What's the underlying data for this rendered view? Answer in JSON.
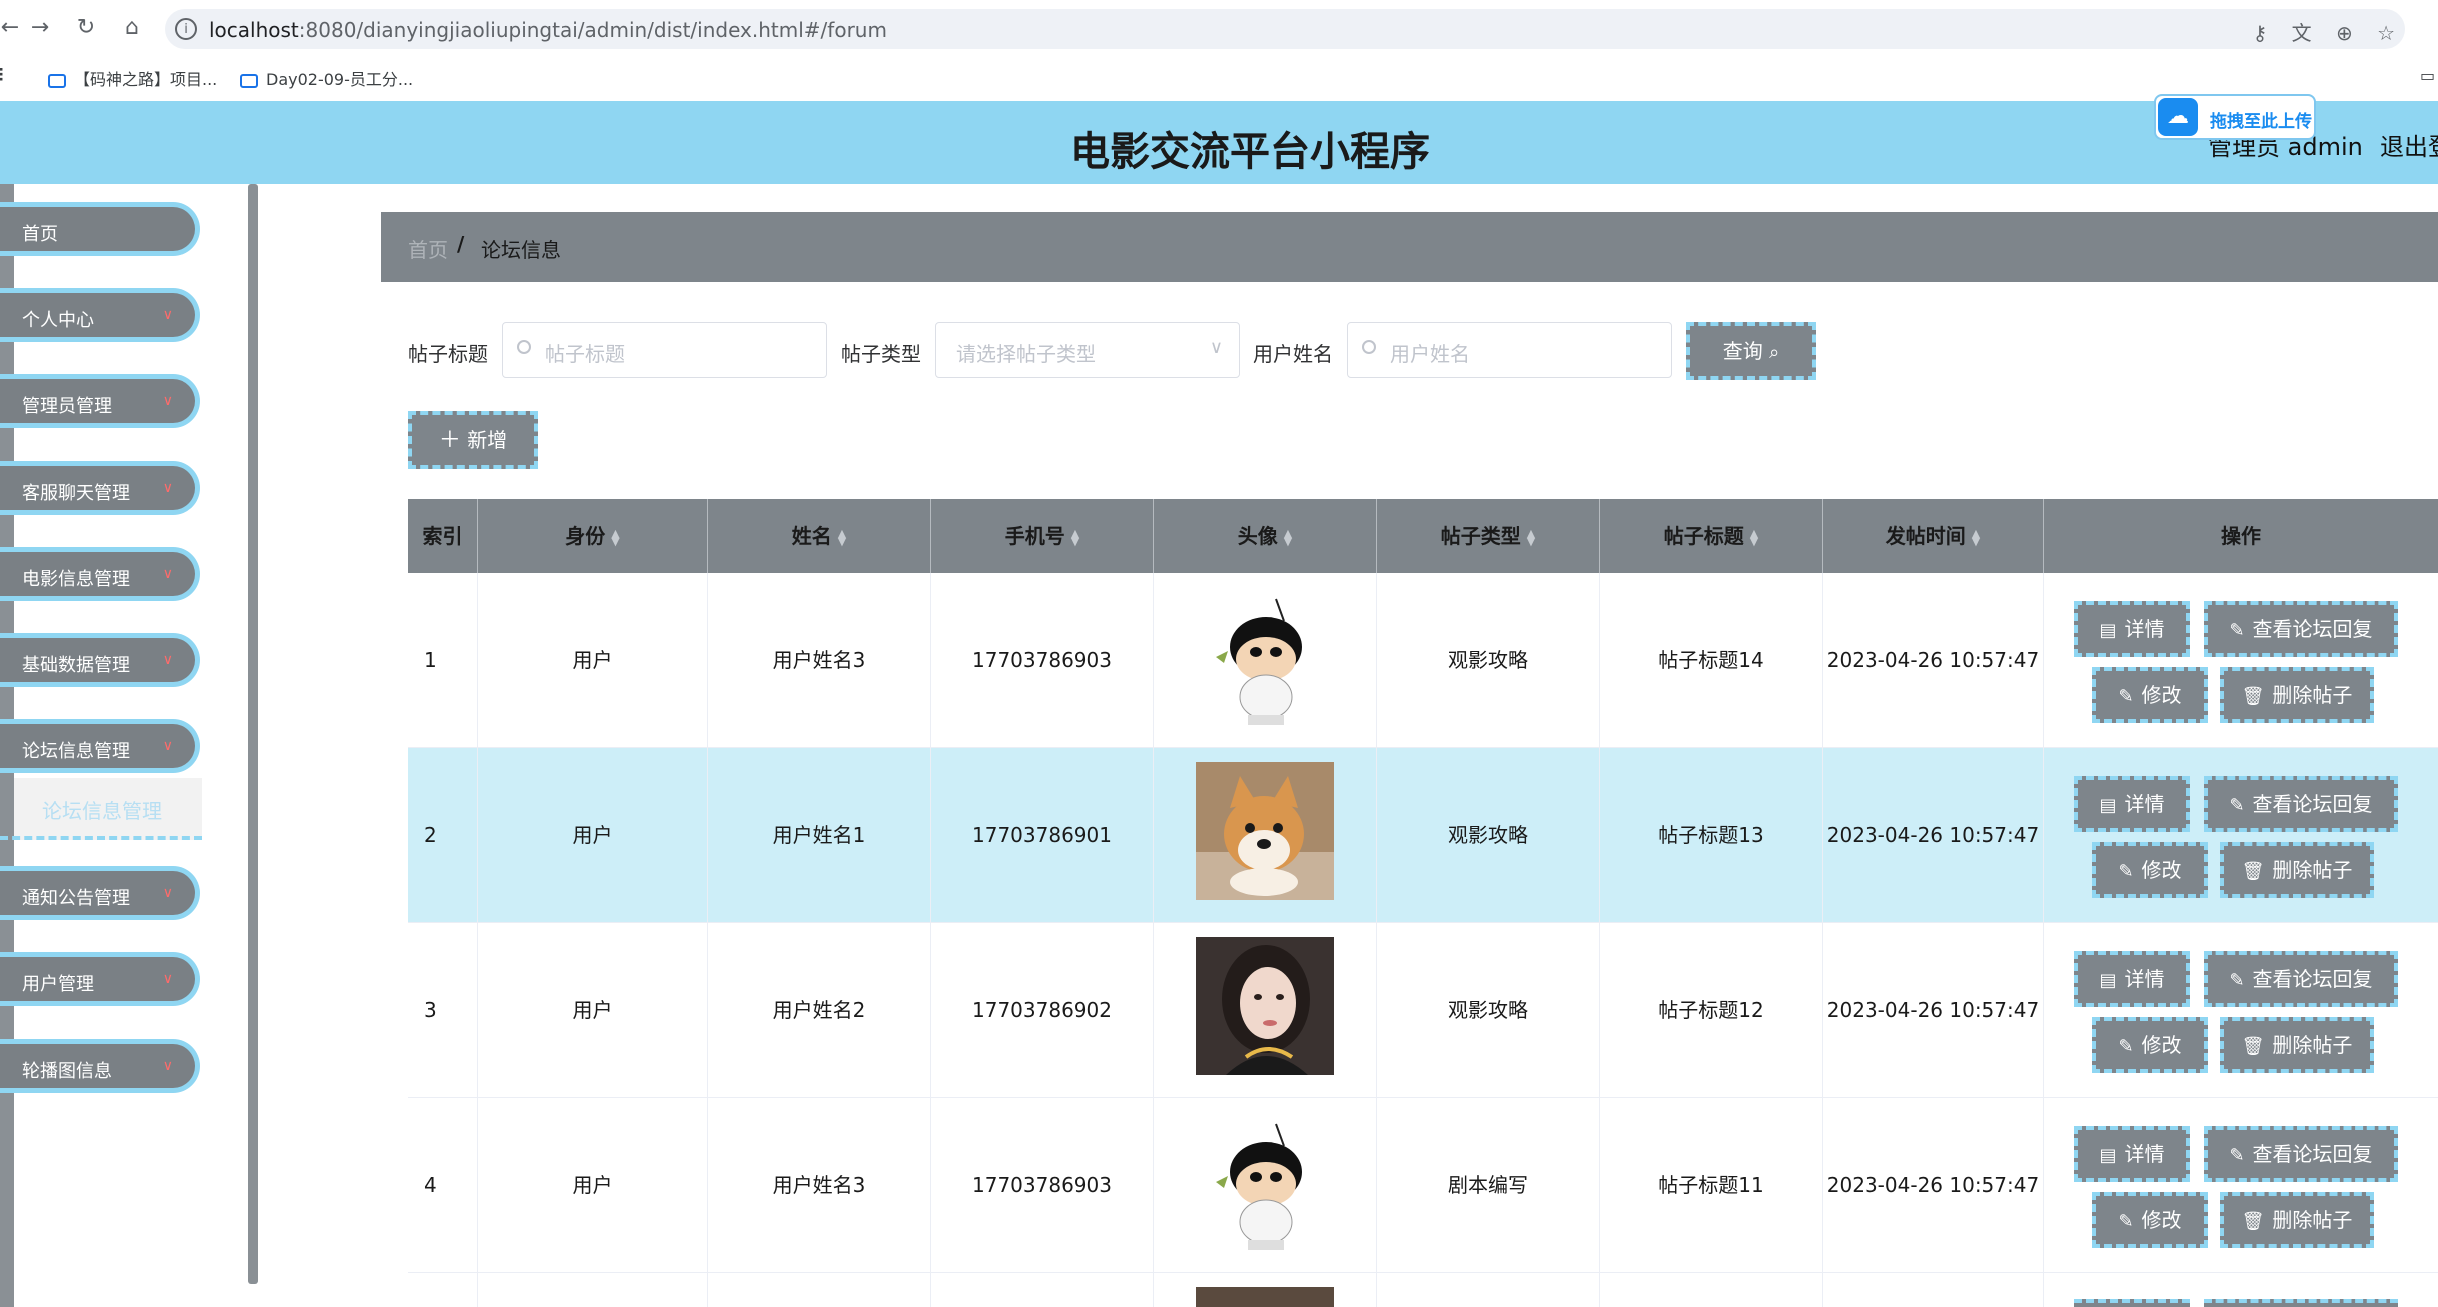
{
  "browser": {
    "url_host": "localhost",
    "url_rest": ":8080/dianyingjiaoliupingtai/admin/dist/index.html#/forum",
    "bookmarks": [
      "【码神之路】项目...",
      "Day02-09-员工分..."
    ]
  },
  "header": {
    "title": "电影交流平台小程序",
    "admin_label": "管理员 admin",
    "logout_label": "退出登",
    "upload_label": "拖拽至此上传"
  },
  "sidebar": {
    "items": [
      {
        "label": "首页",
        "has_arrow": false
      },
      {
        "label": "个人中心",
        "has_arrow": true
      },
      {
        "label": "管理员管理",
        "has_arrow": true
      },
      {
        "label": "客服聊天管理",
        "has_arrow": true
      },
      {
        "label": "电影信息管理",
        "has_arrow": true
      },
      {
        "label": "基础数据管理",
        "has_arrow": true
      },
      {
        "label": "论坛信息管理",
        "has_arrow": true
      },
      {
        "label": "通知公告管理",
        "has_arrow": true
      },
      {
        "label": "用户管理",
        "has_arrow": true
      },
      {
        "label": "轮播图信息",
        "has_arrow": true
      }
    ],
    "active_submenu": "论坛信息管理"
  },
  "breadcrumb": {
    "home": "首页",
    "separator": "/",
    "current": "论坛信息"
  },
  "search": {
    "title_label": "帖子标题",
    "title_placeholder": "帖子标题",
    "type_label": "帖子类型",
    "type_placeholder": "请选择帖子类型",
    "user_label": "用户姓名",
    "user_placeholder": "用户姓名",
    "query_button": "查询",
    "add_button": "新增"
  },
  "table": {
    "columns": [
      "索引",
      "身份",
      "姓名",
      "手机号",
      "头像",
      "帖子类型",
      "帖子标题",
      "发帖时间",
      "操作"
    ],
    "rows": [
      {
        "index": "1",
        "role": "用户",
        "name": "用户姓名3",
        "phone": "17703786903",
        "avatar": "cartoon-boy",
        "type": "观影攻略",
        "title": "帖子标题14",
        "time": "2023-04-26 10:57:47"
      },
      {
        "index": "2",
        "role": "用户",
        "name": "用户姓名1",
        "phone": "17703786901",
        "avatar": "shiba-dog",
        "type": "观影攻略",
        "title": "帖子标题13",
        "time": "2023-04-26 10:57:47"
      },
      {
        "index": "3",
        "role": "用户",
        "name": "用户姓名2",
        "phone": "17703786902",
        "avatar": "woman-portrait",
        "type": "观影攻略",
        "title": "帖子标题12",
        "time": "2023-04-26 10:57:47"
      },
      {
        "index": "4",
        "role": "用户",
        "name": "用户姓名3",
        "phone": "17703786903",
        "avatar": "cartoon-boy",
        "type": "剧本编写",
        "title": "帖子标题11",
        "time": "2023-04-26 10:57:47"
      }
    ],
    "actions": {
      "detail": "详情",
      "view_replies": "查看论坛回复",
      "edit": "修改",
      "delete": "删除帖子"
    }
  },
  "colors": {
    "header_bg": "#8fd6f2",
    "panel_gray": "#7e858b",
    "dash_accent": "#8fd6f2",
    "row_highlight": "#cdeef8"
  }
}
